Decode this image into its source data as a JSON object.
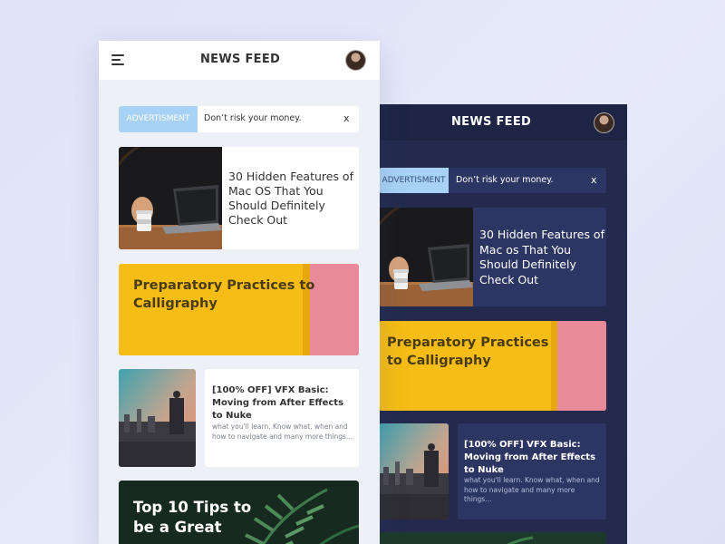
{
  "colors": {
    "background": "#e2e6f8",
    "dark_panel": "#232a4e",
    "dark_card": "#2d3562",
    "ad_tag": "#a8d2f5",
    "accent_yellow": "#f5bd15",
    "accent_pink": "#e98a9b"
  },
  "light": {
    "header": {
      "title": "NEWS FEED",
      "menu_icon": "hamburger-menu-icon",
      "avatar": "user-avatar"
    },
    "ad": {
      "tag": "ADVERTISMENT",
      "text": "Don’t risk your money.",
      "close": "x"
    },
    "cards": [
      {
        "headline": "30 Hidden Features of Mac OS That You Should Definitely Check Out"
      },
      {
        "headline": "Preparatory Practices to Calligraphy"
      },
      {
        "headline": "[100% OFF] VFX Basic: Moving from After Effects to Nuke",
        "description": "what you'll learn. Know what, when and how to navigate and many more things..."
      },
      {
        "headline": "Top 10 Tips to be a Great"
      }
    ]
  },
  "dark": {
    "header": {
      "title": "NEWS FEED",
      "avatar": "user-avatar"
    },
    "ad": {
      "tag": "ADVERTISMENT",
      "text": "Don’t risk your money.",
      "close": "x"
    },
    "cards": [
      {
        "headline": "30 Hidden Features of Mac os That You Should Definitely Check Out"
      },
      {
        "headline": "Preparatory Practices to Calligraphy"
      },
      {
        "headline": "[100% OFF] VFX Basic: Moving from After Effects to Nuke",
        "description": "what you'll learn. Know what, when and how to navigate and many more things..."
      }
    ]
  }
}
